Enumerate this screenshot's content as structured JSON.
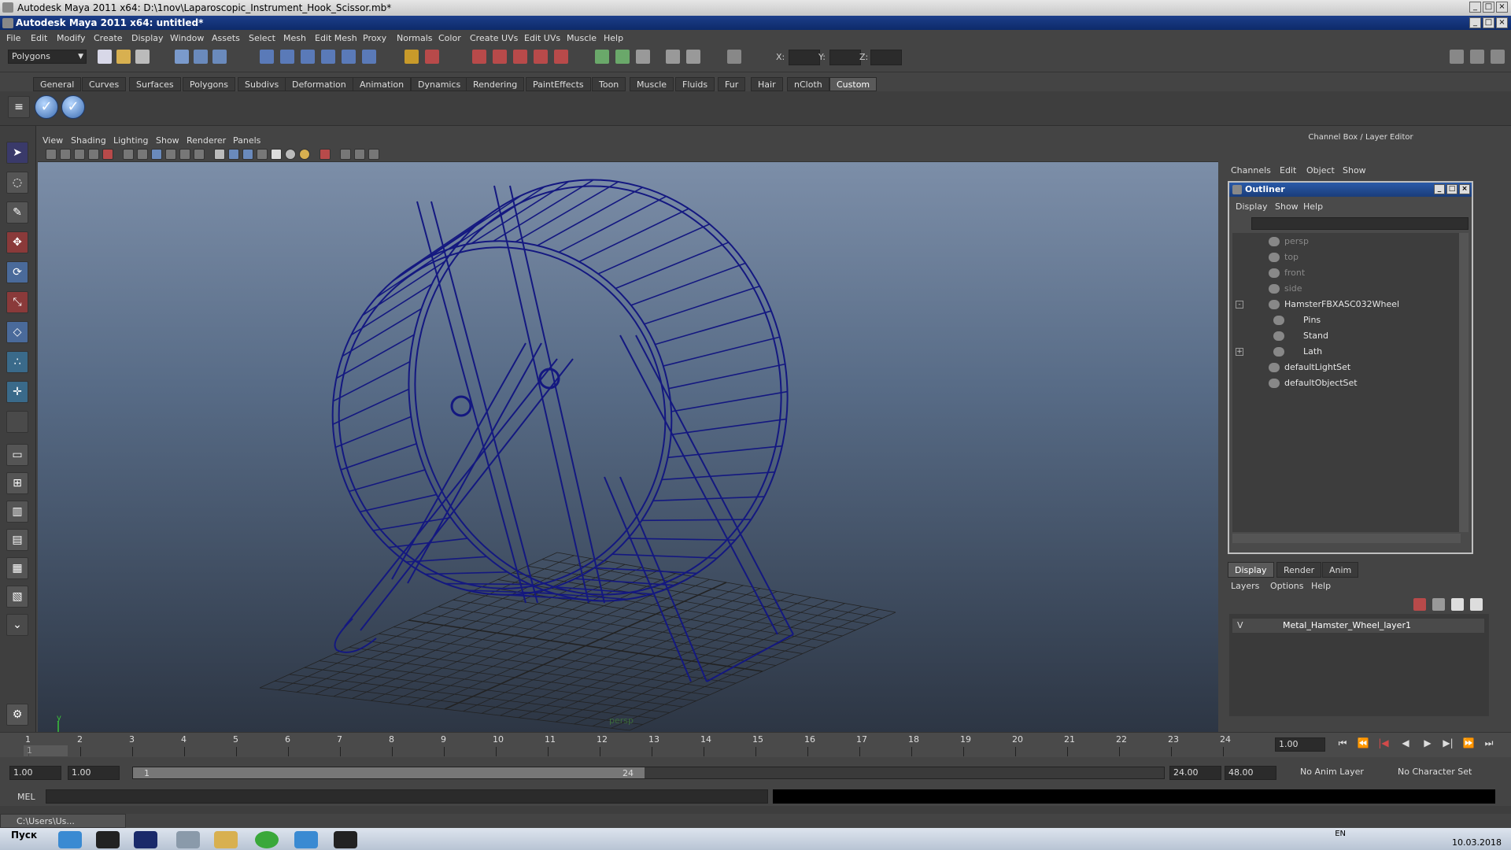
{
  "window": {
    "outer_title": "Autodesk Maya 2011 x64: D:\\1nov\\Laparoscopic_Instrument_Hook_Scissor.mb*",
    "inner_title": "Autodesk Maya 2011 x64: untitled*"
  },
  "menubar": [
    "File",
    "Edit",
    "Modify",
    "Create",
    "Display",
    "Window",
    "Assets",
    "Select",
    "Mesh",
    "Edit Mesh",
    "Proxy",
    "Normals",
    "Color",
    "Create UVs",
    "Edit UVs",
    "Muscle",
    "Help"
  ],
  "statusline": {
    "mode": "Polygons",
    "coord_x_label": "X:",
    "coord_y_label": "Y:",
    "coord_z_label": "Z:"
  },
  "shelf": {
    "tabs": [
      "General",
      "Curves",
      "Surfaces",
      "Polygons",
      "Subdivs",
      "Deformation",
      "Animation",
      "Dynamics",
      "Rendering",
      "PaintEffects",
      "Toon",
      "Muscle",
      "Fluids",
      "Fur",
      "Hair",
      "nCloth",
      "Custom"
    ],
    "active_tab": "Custom"
  },
  "panel_menu": [
    "View",
    "Shading",
    "Lighting",
    "Show",
    "Renderer",
    "Panels"
  ],
  "viewport": {
    "camera": "persp",
    "axis_y": "y",
    "axis_x": "x",
    "wire_color": "#141880",
    "grid_color": "#222222"
  },
  "channel_box": {
    "title": "Channel Box / Layer Editor",
    "menu": [
      "Channels",
      "Edit",
      "Object",
      "Show"
    ]
  },
  "outliner": {
    "title": "Outliner",
    "menu": [
      "Display",
      "Show",
      "Help"
    ],
    "items": [
      {
        "label": "persp",
        "depth": 0,
        "dim": true,
        "icon": "camera-icon"
      },
      {
        "label": "top",
        "depth": 0,
        "dim": true,
        "icon": "camera-icon"
      },
      {
        "label": "front",
        "depth": 0,
        "dim": true,
        "icon": "camera-icon"
      },
      {
        "label": "side",
        "depth": 0,
        "dim": true,
        "icon": "camera-icon"
      },
      {
        "label": "HamsterFBXASC032Wheel",
        "depth": 0,
        "dim": false,
        "icon": "group-icon",
        "expander": "-"
      },
      {
        "label": "Pins",
        "depth": 1,
        "dim": false,
        "icon": "mesh-icon"
      },
      {
        "label": "Stand",
        "depth": 1,
        "dim": false,
        "icon": "mesh-icon"
      },
      {
        "label": "Lath",
        "depth": 1,
        "dim": false,
        "icon": "mesh-icon",
        "expander": "+"
      },
      {
        "label": "defaultLightSet",
        "depth": 0,
        "dim": false,
        "icon": "set-icon"
      },
      {
        "label": "defaultObjectSet",
        "depth": 0,
        "dim": false,
        "icon": "set-icon"
      }
    ]
  },
  "layer_editor": {
    "tabs": [
      "Display",
      "Render",
      "Anim"
    ],
    "active_tab": "Display",
    "menu": [
      "Layers",
      "Options",
      "Help"
    ],
    "layer": {
      "visible": "V",
      "name": "Metal_Hamster_Wheel_layer1"
    }
  },
  "timeline": {
    "ticks": [
      "1",
      "2",
      "3",
      "4",
      "5",
      "6",
      "7",
      "8",
      "9",
      "10",
      "11",
      "12",
      "13",
      "14",
      "15",
      "16",
      "17",
      "18",
      "19",
      "20",
      "21",
      "22",
      "23",
      "24"
    ],
    "current_frame": "1.00",
    "cursor_label": "1"
  },
  "range": {
    "start": "1.00",
    "playback_start": "1.00",
    "inner_start": "1",
    "inner_end": "24",
    "playback_end": "24.00",
    "end": "48.00",
    "anim_layer": "No Anim Layer",
    "character_set": "No Character Set"
  },
  "cmdline": {
    "label": "MEL"
  },
  "taskbar": {
    "window_panel": "C:\\Users\\Us...",
    "start": "Пуск",
    "date": "10.03.2018",
    "lang": "EN"
  }
}
